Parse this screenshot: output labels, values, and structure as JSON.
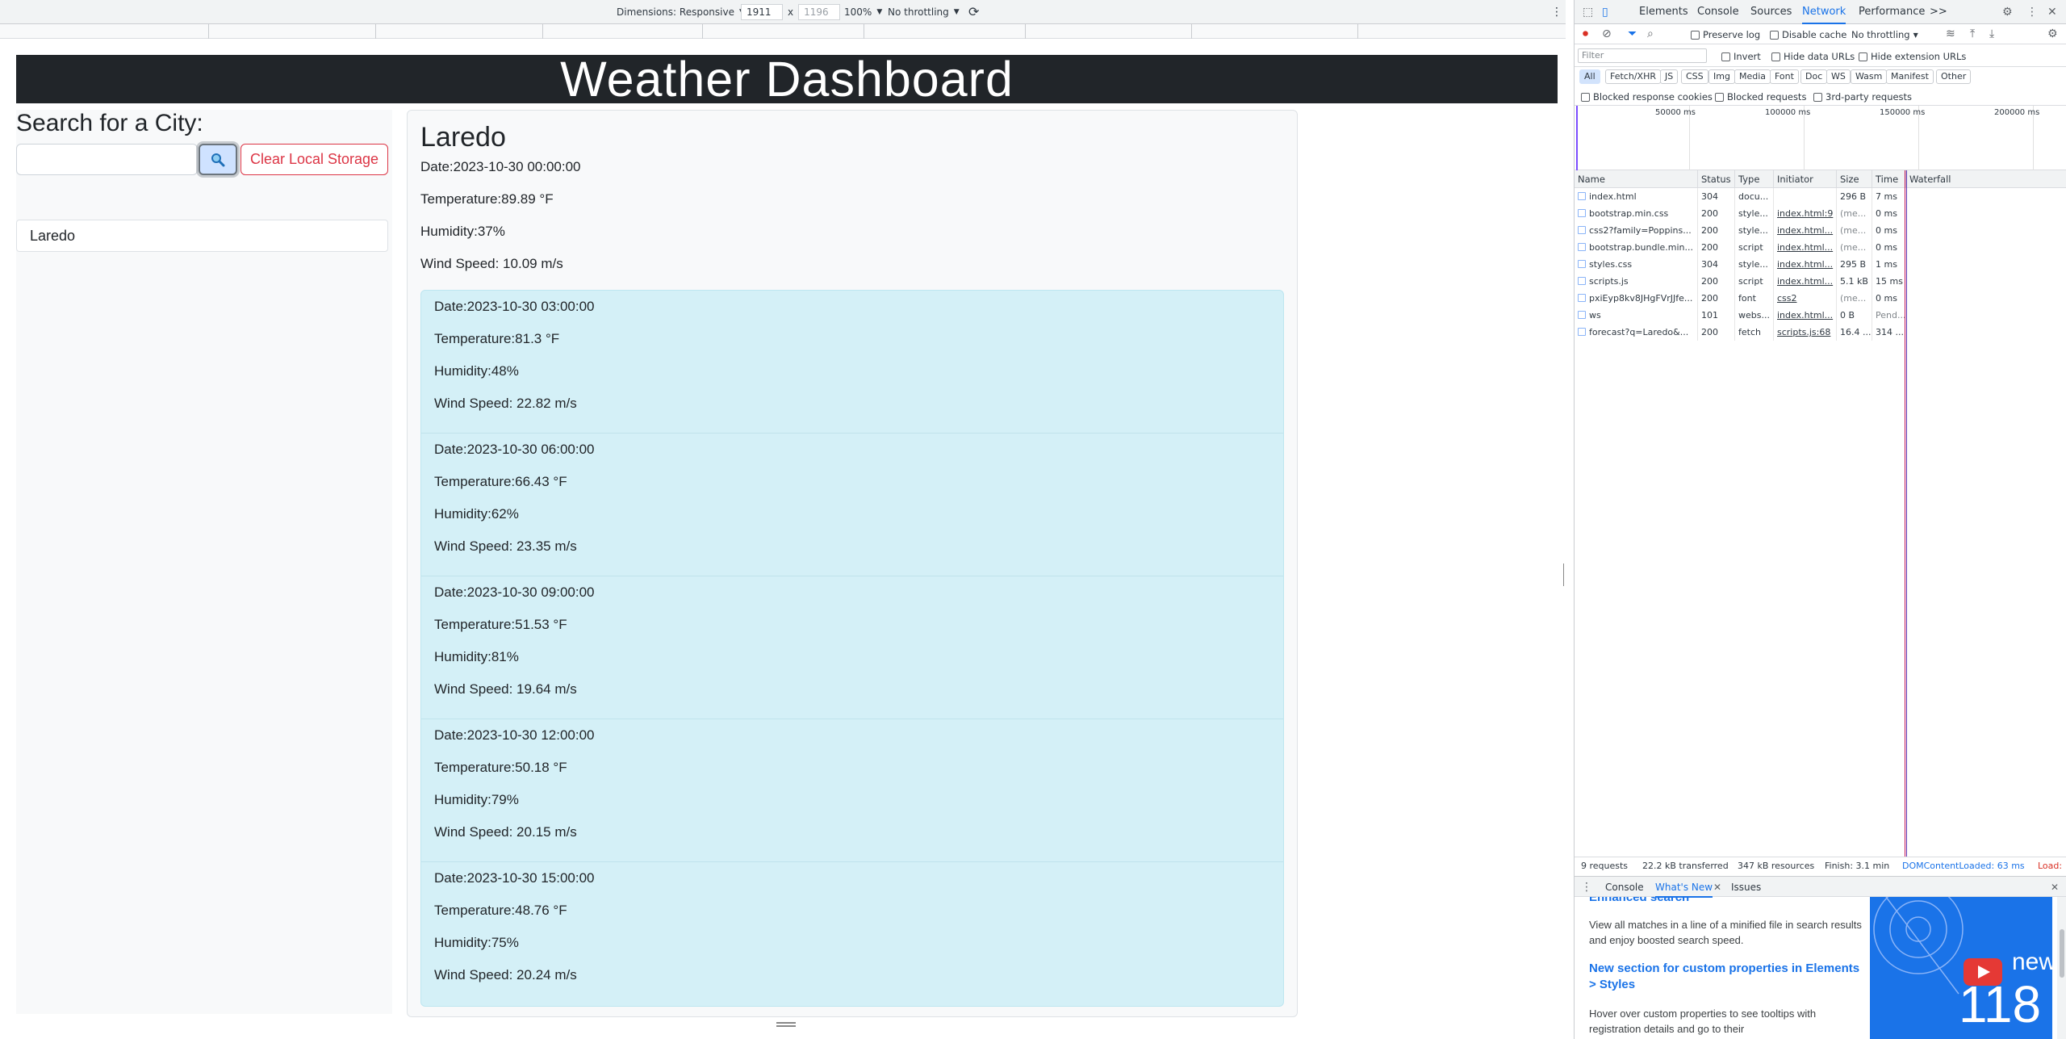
{
  "devtools_toolbar": {
    "dimensions_label": "Dimensions: Responsive",
    "width_value": "1911",
    "times_sign": "x",
    "height_value": "1196",
    "zoom_label": "100%",
    "throttle_label": "No throttling"
  },
  "app": {
    "title": "Weather Dashboard",
    "search_heading": "Search for a City:",
    "search_input_value": "",
    "search_icon": "magnifier-icon",
    "clear_button_label": "Clear Local Storage",
    "history": [
      "Laredo"
    ]
  },
  "current": {
    "city": "Laredo",
    "date": "Date:2023-10-30 00:00:00",
    "temperature": "Temperature:89.89 °F",
    "humidity": "Humidity:37%",
    "wind": "Wind Speed: 10.09 m/s"
  },
  "forecast": [
    {
      "date": "Date:2023-10-30 03:00:00",
      "temperature": "Temperature:81.3 °F",
      "humidity": "Humidity:48%",
      "wind": "Wind Speed: 22.82 m/s"
    },
    {
      "date": "Date:2023-10-30 06:00:00",
      "temperature": "Temperature:66.43 °F",
      "humidity": "Humidity:62%",
      "wind": "Wind Speed: 23.35 m/s"
    },
    {
      "date": "Date:2023-10-30 09:00:00",
      "temperature": "Temperature:51.53 °F",
      "humidity": "Humidity:81%",
      "wind": "Wind Speed: 19.64 m/s"
    },
    {
      "date": "Date:2023-10-30 12:00:00",
      "temperature": "Temperature:50.18 °F",
      "humidity": "Humidity:79%",
      "wind": "Wind Speed: 20.15 m/s"
    },
    {
      "date": "Date:2023-10-30 15:00:00",
      "temperature": "Temperature:48.76 °F",
      "humidity": "Humidity:75%",
      "wind": "Wind Speed: 20.24 m/s"
    }
  ],
  "devtools": {
    "tabs": [
      "Elements",
      "Console",
      "Sources",
      "Network",
      "Performance"
    ],
    "active_tab": "Network",
    "more_tabs": ">>",
    "preserve_log": "Preserve log",
    "disable_cache": "Disable cache",
    "throttling": "No throttling",
    "filter_placeholder": "Filter",
    "invert": "Invert",
    "hide_data_urls": "Hide data URLs",
    "hide_extension_urls": "Hide extension URLs",
    "type_filters": [
      "All",
      "Fetch/XHR",
      "JS",
      "CSS",
      "Img",
      "Media",
      "Font",
      "Doc",
      "WS",
      "Wasm",
      "Manifest",
      "Other"
    ],
    "blocked_response_cookies": "Blocked response cookies",
    "blocked_requests": "Blocked requests",
    "third_party_requests": "3rd-party requests",
    "overview_ticks": [
      "50000 ms",
      "100000 ms",
      "150000 ms",
      "200000 ms"
    ],
    "columns": [
      "Name",
      "Status",
      "Type",
      "Initiator",
      "Size",
      "Time",
      "Waterfall"
    ],
    "requests": [
      {
        "name": "index.html",
        "status": "304",
        "type": "docu...",
        "initiator": "",
        "size": "296 B",
        "time": "7 ms"
      },
      {
        "name": "bootstrap.min.css",
        "status": "200",
        "type": "style...",
        "initiator": "index.html:9",
        "size": "(me...",
        "time": "0 ms"
      },
      {
        "name": "css2?family=Poppins...",
        "status": "200",
        "type": "style...",
        "initiator": "index.html...",
        "size": "(me...",
        "time": "0 ms"
      },
      {
        "name": "bootstrap.bundle.min...",
        "status": "200",
        "type": "script",
        "initiator": "index.html...",
        "size": "(me...",
        "time": "0 ms"
      },
      {
        "name": "styles.css",
        "status": "304",
        "type": "style...",
        "initiator": "index.html...",
        "size": "295 B",
        "time": "1 ms"
      },
      {
        "name": "scripts.js",
        "status": "200",
        "type": "script",
        "initiator": "index.html...",
        "size": "5.1 kB",
        "time": "15 ms"
      },
      {
        "name": "pxiEyp8kv8JHgFVrJJfe...",
        "status": "200",
        "type": "font",
        "initiator": "css2",
        "size": "(me...",
        "time": "0 ms"
      },
      {
        "name": "ws",
        "status": "101",
        "type": "webs...",
        "initiator": "index.html...",
        "size": "0 B",
        "time": "Pend..."
      },
      {
        "name": "forecast?q=Laredo&...",
        "status": "200",
        "type": "fetch",
        "initiator": "scripts.js:68",
        "size": "16.4 ...",
        "time": "314 ..."
      }
    ],
    "summary": {
      "requests": "9 requests",
      "transferred": "22.2 kB transferred",
      "resources": "347 kB resources",
      "finish": "Finish: 3.1 min",
      "dcl": "DOMContentLoaded: 63 ms",
      "load": "Load:"
    },
    "drawer_tabs": [
      "Console",
      "What's New",
      "Issues"
    ],
    "whats_new": {
      "partial_heading": "Enhanced search",
      "body1": "View all matches in a line of a minified file in search results and enjoy boosted search speed.",
      "heading2": "New section for custom properties in Elements > Styles",
      "body2": "Hover over custom properties to see tooltips with registration details and go to their",
      "video_word": "new",
      "video_number": "118"
    }
  }
}
